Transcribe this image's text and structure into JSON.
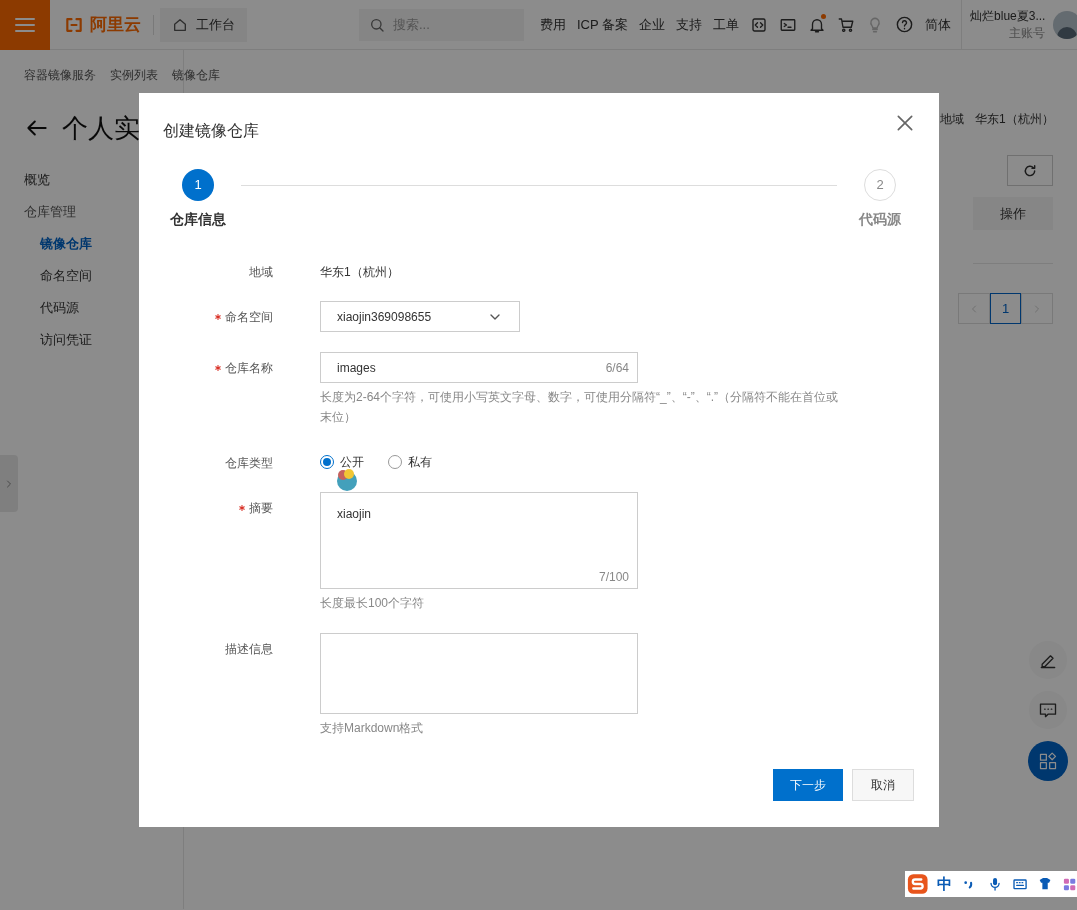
{
  "top_bar": {
    "logo": "阿里云",
    "workbench": "工作台",
    "search": {
      "placeholder": "搜索..."
    },
    "links": [
      "费用",
      "ICP 备案",
      "企业",
      "支持",
      "工单"
    ],
    "notification_unread": true,
    "language": "简体",
    "user": {
      "name": "灿烂blue夏3...",
      "account_type": "主账号"
    }
  },
  "breadcrumb": [
    "容器镜像服务",
    "实例列表",
    "镜像仓库"
  ],
  "page": {
    "title": "个人实",
    "region_label": "地域",
    "region_value": "华东1（杭州）"
  },
  "sidebar": {
    "items": [
      {
        "label": "概览",
        "selected": false
      },
      {
        "label": "仓库管理",
        "selected": false,
        "children": [
          {
            "label": "镜像仓库",
            "selected": true
          },
          {
            "label": "命名空间",
            "selected": false
          },
          {
            "label": "代码源",
            "selected": false
          },
          {
            "label": "访问凭证",
            "selected": false
          }
        ]
      }
    ]
  },
  "table": {
    "columns": [
      "操作"
    ],
    "pagination": [
      {
        "label": "1",
        "selected": true
      }
    ]
  },
  "dialog": {
    "title": "创建镜像仓库",
    "steps": [
      {
        "number": "1",
        "label": "仓库信息",
        "selected": true
      },
      {
        "number": "2",
        "label": "代码源",
        "selected": false
      }
    ],
    "fields": [
      {
        "kind": "static",
        "label": "地域",
        "required": false,
        "value": "华东1（杭州）"
      },
      {
        "kind": "select",
        "label": "命名空间",
        "required": true,
        "value": "xiaojin369098655"
      },
      {
        "kind": "input",
        "label": "仓库名称",
        "required": true,
        "value": "images",
        "counter": "6/64",
        "help": "长度为2-64个字符，可使用小写英文字母、数字，可使用分隔符“_”、“-”、“.”（分隔符不能在首位或末位）"
      },
      {
        "kind": "radio",
        "label": "仓库类型",
        "required": false,
        "options": [
          {
            "label": "公开",
            "selected": true
          },
          {
            "label": "私有",
            "selected": false
          }
        ]
      },
      {
        "kind": "textarea",
        "label": "摘要",
        "required": true,
        "value": "xiaojin",
        "counter": "7/100",
        "help": "长度最长100个字符"
      },
      {
        "kind": "textarea",
        "label": "描述信息",
        "required": false,
        "help": "支持Markdown格式"
      }
    ],
    "buttons": [
      {
        "label": "下一步",
        "kind": "primary"
      },
      {
        "label": "取消",
        "kind": "default"
      }
    ]
  },
  "ime_toolbar": {
    "mode": "中"
  }
}
